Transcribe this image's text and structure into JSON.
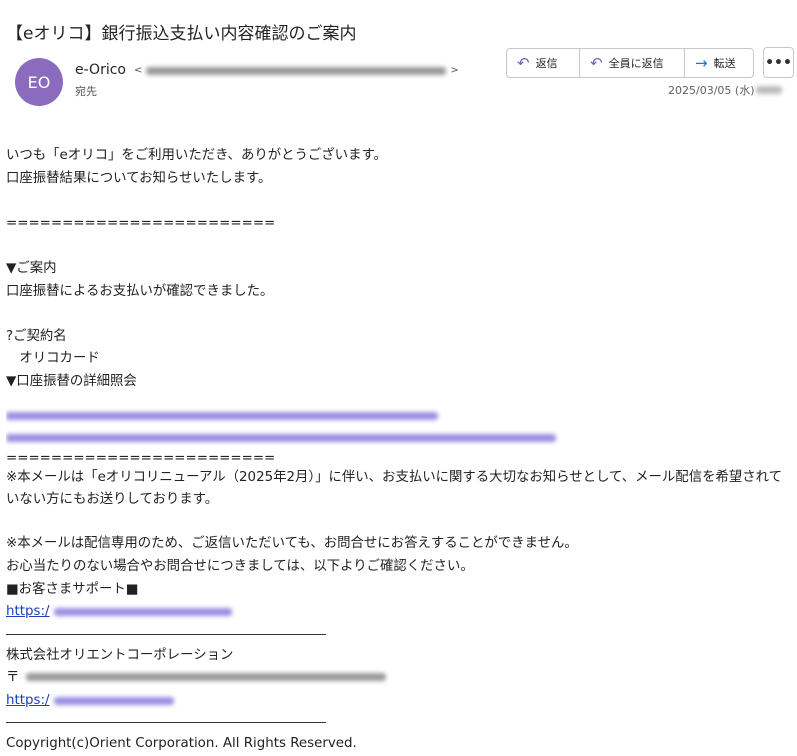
{
  "subject": "【eオリコ】銀行振込支払い内容確認のご案内",
  "sender": {
    "avatar_initials": "EO",
    "name": "e-Orico",
    "email_open": "<",
    "email_close": ">",
    "to_label": "宛先"
  },
  "actions": {
    "reply": "返信",
    "reply_all": "全員に返信",
    "forward": "転送",
    "more": "•••"
  },
  "date": "2025/03/05 (水)",
  "body": {
    "greeting": "いつも「eオリコ」をご利用いただき、ありがとうございます。",
    "notice": "口座振替結果についてお知らせいたします。",
    "separator1": "========================",
    "guide_heading": "▼ご案内",
    "guide_text": "口座振替によるお支払いが確認できました。",
    "contract_label": "?ご契約名",
    "contract_value": "　オリコカード",
    "detail_heading": "▼口座振替の詳細照会",
    "separator2": "========================",
    "note1": "※本メールは「eオリコリニューアル（2025年2月）」に伴い、お支払いに関する大切なお知らせとして、メール配信を希望されていない方にもお送りしております。",
    "note2": "※本メールは配信専用のため、ご返信いただいても、お問合せにお答えすることができません。",
    "note3": "お心当たりのない場合やお問合せにつきましては、以下よりご確認ください。",
    "support_heading": "■お客さまサポート■",
    "support_link_prefix": "https:/",
    "company": "株式会社オリエントコーポレーション",
    "postal_prefix": "〒",
    "company_link_prefix": "https:/",
    "copyright": "Copyright(c)Orient Corporation. All Rights Reserved."
  },
  "colors": {
    "avatar_bg": "#8a6bbe",
    "link": "#1a3fbf",
    "reply_icon": "#7b5fb0",
    "forward_icon": "#2a6fc8"
  },
  "icons": {
    "reply": "reply-icon",
    "reply_all": "reply-all-icon",
    "forward": "forward-arrow-icon",
    "more": "more-options-icon"
  }
}
